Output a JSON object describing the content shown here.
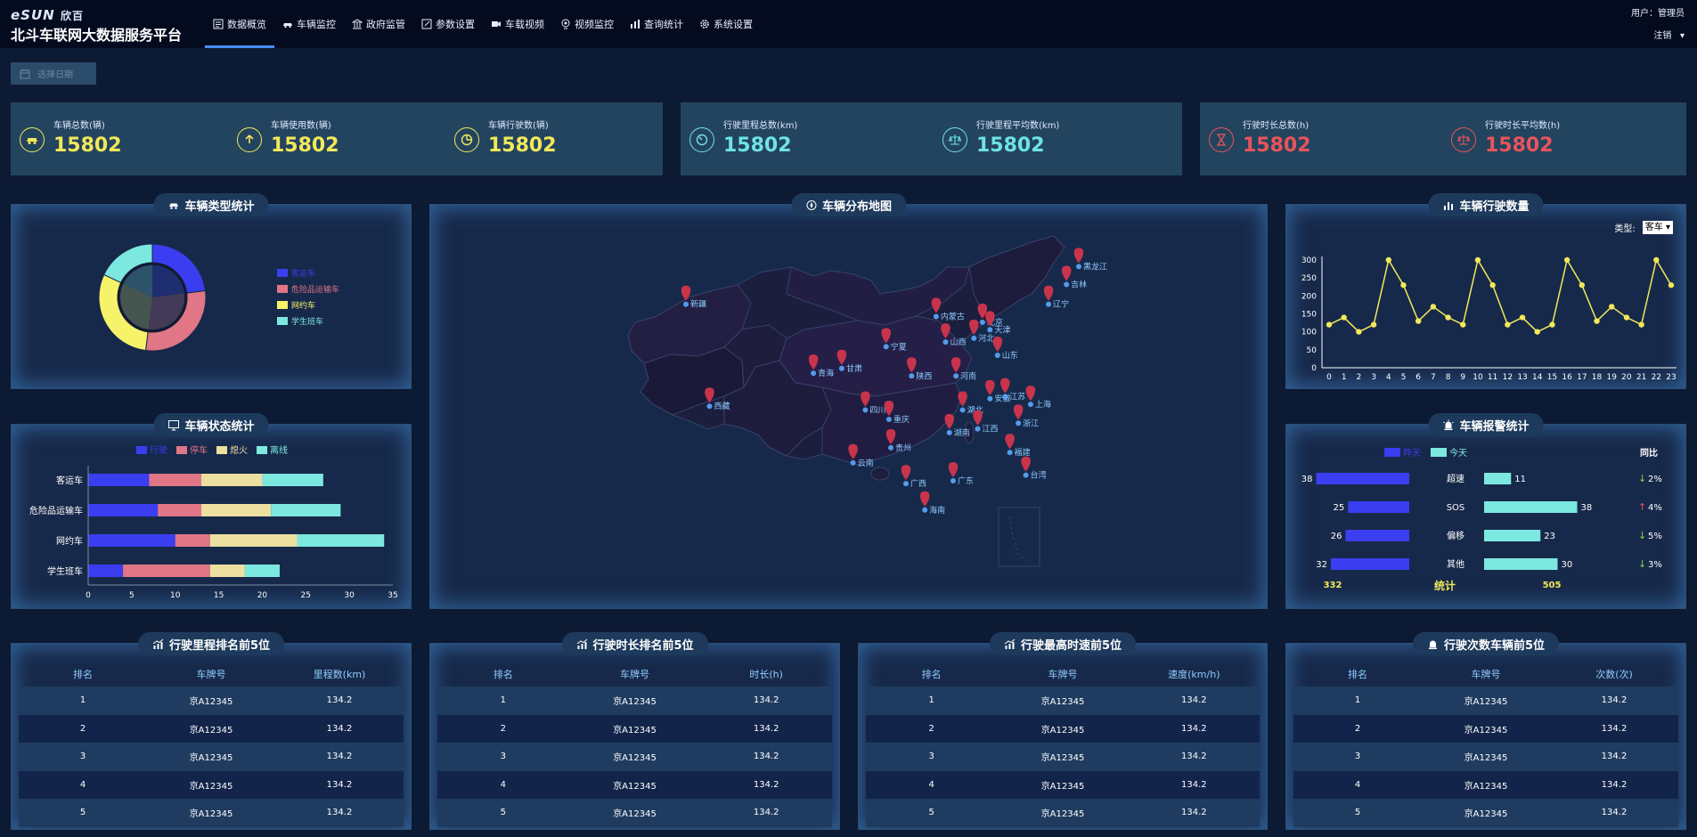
{
  "header": {
    "logo": "eSUN",
    "logo_cn": "欣百",
    "title": "北斗车联网大数据服务平台",
    "nav": [
      {
        "label": "数据概览",
        "icon": "dashboard-icon",
        "active": true
      },
      {
        "label": "车辆监控",
        "icon": "car-icon"
      },
      {
        "label": "政府监管",
        "icon": "government-icon"
      },
      {
        "label": "参数设置",
        "icon": "edit-icon"
      },
      {
        "label": "车载视频",
        "icon": "video-camera-icon"
      },
      {
        "label": "视频监控",
        "icon": "webcam-icon"
      },
      {
        "label": "查询统计",
        "icon": "bar-chart-icon"
      },
      {
        "label": "系统设置",
        "icon": "gear-icon"
      }
    ],
    "user_label": "用户：管理员",
    "logout_label": "注销"
  },
  "date_picker": {
    "placeholder": "选择日期"
  },
  "stats": [
    {
      "label": "车辆总数(辆)",
      "value": "15802",
      "icon": "car-icon",
      "color": "#f2e85a"
    },
    {
      "label": "车辆使用数(辆)",
      "value": "15802",
      "icon": "upload-icon",
      "color": "#f2e85a"
    },
    {
      "label": "车辆行驶数(辆)",
      "value": "15802",
      "icon": "pie-icon",
      "color": "#f2e85a"
    },
    {
      "label": "行驶里程总数(km)",
      "value": "15802",
      "icon": "timer-icon",
      "color": "#6fe3e3"
    },
    {
      "label": "行驶里程平均数(km)",
      "value": "15802",
      "icon": "scale-icon",
      "color": "#6fe3e3"
    },
    {
      "label": "行驶时长总数(h)",
      "value": "15802",
      "icon": "hourglass-icon",
      "color": "#e8545a"
    },
    {
      "label": "行驶时长平均数(h)",
      "value": "15802",
      "icon": "scale-icon",
      "color": "#e8545a"
    }
  ],
  "panels": {
    "vehicle_type": "车辆类型统计",
    "vehicle_status": "车辆状态统计",
    "map": "车辆分布地图",
    "travel_count": "车辆行驶数量",
    "alarm": "车辆报警统计",
    "mileage_rank": "行驶里程排名前5位",
    "duration_rank": "行驶时长排名前5位",
    "speed_rank": "行驶最高时速前5位",
    "trips_rank": "行驶次数车辆前5位"
  },
  "chart_data": [
    {
      "type": "pie",
      "name": "vehicle_type",
      "categories": [
        "客运车",
        "危险品运输车",
        "网约车",
        "学生班车"
      ],
      "values": [
        23,
        29,
        30,
        18
      ],
      "colors": [
        "#3a3ef0",
        "#e07686",
        "#f6f36a",
        "#7de8e0"
      ],
      "legend": "right"
    },
    {
      "type": "bar",
      "name": "vehicle_status",
      "orientation": "horizontal",
      "stacked": true,
      "categories": [
        "客运车",
        "危险品运输车",
        "网约车",
        "学生班车"
      ],
      "series": [
        {
          "name": "行驶",
          "values": [
            7,
            8,
            10,
            4
          ],
          "color": "#3a3ef0"
        },
        {
          "name": "停车",
          "values": [
            6,
            5,
            4,
            10
          ],
          "color": "#e07686"
        },
        {
          "name": "熄火",
          "values": [
            7,
            8,
            10,
            4
          ],
          "color": "#ecdfa0"
        },
        {
          "name": "离线",
          "values": [
            7,
            8,
            10,
            4
          ],
          "color": "#7de8e0"
        }
      ],
      "xlim": [
        0,
        35
      ],
      "xticks": [
        0,
        5,
        10,
        15,
        20,
        25,
        30,
        35
      ],
      "legend": "top"
    },
    {
      "type": "line",
      "name": "travel_count",
      "x": [
        0,
        1,
        2,
        3,
        4,
        5,
        6,
        7,
        8,
        9,
        10,
        11,
        12,
        13,
        14,
        15,
        16,
        17,
        18,
        19,
        20,
        21,
        22,
        23
      ],
      "values": [
        120,
        140,
        100,
        120,
        300,
        230,
        130,
        170,
        140,
        120,
        300,
        230,
        120,
        140,
        100,
        120,
        300,
        230,
        130,
        170,
        140,
        120,
        300,
        230
      ],
      "ylim": [
        0,
        300
      ],
      "yticks": [
        0,
        50,
        100,
        150,
        200,
        250,
        300
      ],
      "color": "#f2e85a",
      "selector_label": "类型:",
      "selector_value": "客车"
    },
    {
      "type": "bar",
      "name": "alarm",
      "categories": [
        "超速",
        "SOS",
        "偏移",
        "其他"
      ],
      "series": [
        {
          "name": "昨天",
          "values": [
            38,
            25,
            26,
            32
          ],
          "color": "#3a3ef0"
        },
        {
          "name": "今天",
          "values": [
            11,
            38,
            23,
            30
          ],
          "color": "#7de8e0"
        }
      ],
      "yoy_header": "同比",
      "yoy": [
        {
          "dir": "down",
          "value": "2%"
        },
        {
          "dir": "up",
          "value": "4%"
        },
        {
          "dir": "down",
          "value": "5%"
        },
        {
          "dir": "down",
          "value": "3%"
        }
      ],
      "total_label": "统计",
      "total_yesterday": "332",
      "total_today": "505"
    }
  ],
  "map": {
    "markers": [
      {
        "name": "新疆",
        "lon": 85.0,
        "lat": 41.8
      },
      {
        "name": "西藏",
        "lon": 87.5,
        "lat": 31.0
      },
      {
        "name": "宁夏",
        "lon": 106.2,
        "lat": 37.3
      },
      {
        "name": "甘肃",
        "lon": 101.5,
        "lat": 35.0
      },
      {
        "name": "青海",
        "lon": 98.5,
        "lat": 34.5
      },
      {
        "name": "内蒙古",
        "lon": 111.5,
        "lat": 40.5
      },
      {
        "name": "北京",
        "lon": 116.4,
        "lat": 39.9
      },
      {
        "name": "天津",
        "lon": 117.2,
        "lat": 39.1
      },
      {
        "name": "河北",
        "lon": 115.5,
        "lat": 38.2
      },
      {
        "name": "山西",
        "lon": 112.5,
        "lat": 37.8
      },
      {
        "name": "山东",
        "lon": 118.0,
        "lat": 36.4
      },
      {
        "name": "陕西",
        "lon": 108.9,
        "lat": 34.2
      },
      {
        "name": "河南",
        "lon": 113.6,
        "lat": 34.2
      },
      {
        "name": "四川",
        "lon": 104.0,
        "lat": 30.6
      },
      {
        "name": "重庆",
        "lon": 106.5,
        "lat": 29.6
      },
      {
        "name": "湖北",
        "lon": 114.3,
        "lat": 30.6
      },
      {
        "name": "安徽",
        "lon": 117.2,
        "lat": 31.8
      },
      {
        "name": "江苏",
        "lon": 118.8,
        "lat": 32.0
      },
      {
        "name": "上海",
        "lon": 121.5,
        "lat": 31.2
      },
      {
        "name": "浙江",
        "lon": 120.2,
        "lat": 29.2
      },
      {
        "name": "湖南",
        "lon": 112.9,
        "lat": 28.2
      },
      {
        "name": "江西",
        "lon": 115.9,
        "lat": 28.6
      },
      {
        "name": "贵州",
        "lon": 106.7,
        "lat": 26.6
      },
      {
        "name": "云南",
        "lon": 102.7,
        "lat": 25.0
      },
      {
        "name": "广西",
        "lon": 108.3,
        "lat": 22.8
      },
      {
        "name": "广东",
        "lon": 113.3,
        "lat": 23.1
      },
      {
        "name": "福建",
        "lon": 119.3,
        "lat": 26.1
      },
      {
        "name": "台湾",
        "lon": 121.0,
        "lat": 23.7
      },
      {
        "name": "海南",
        "lon": 110.3,
        "lat": 20.0
      },
      {
        "name": "辽宁",
        "lon": 123.4,
        "lat": 41.8
      },
      {
        "name": "吉林",
        "lon": 125.3,
        "lat": 43.9
      },
      {
        "name": "黑龙江",
        "lon": 126.6,
        "lat": 45.8
      }
    ]
  },
  "tables": {
    "mileage": {
      "headers": [
        "排名",
        "车牌号",
        "里程数(km)"
      ],
      "rows": [
        [
          "1",
          "京A12345",
          "134.2"
        ],
        [
          "2",
          "京A12345",
          "134.2"
        ],
        [
          "3",
          "京A12345",
          "134.2"
        ],
        [
          "4",
          "京A12345",
          "134.2"
        ],
        [
          "5",
          "京A12345",
          "134.2"
        ]
      ]
    },
    "duration": {
      "headers": [
        "排名",
        "车牌号",
        "时长(h)"
      ],
      "rows": [
        [
          "1",
          "京A12345",
          "134.2"
        ],
        [
          "2",
          "京A12345",
          "134.2"
        ],
        [
          "3",
          "京A12345",
          "134.2"
        ],
        [
          "4",
          "京A12345",
          "134.2"
        ],
        [
          "5",
          "京A12345",
          "134.2"
        ]
      ]
    },
    "speed": {
      "headers": [
        "排名",
        "车牌号",
        "速度(km/h)"
      ],
      "rows": [
        [
          "1",
          "京A12345",
          "134.2"
        ],
        [
          "2",
          "京A12345",
          "134.2"
        ],
        [
          "3",
          "京A12345",
          "134.2"
        ],
        [
          "4",
          "京A12345",
          "134.2"
        ],
        [
          "5",
          "京A12345",
          "134.2"
        ]
      ]
    },
    "trips": {
      "headers": [
        "排名",
        "车牌号",
        "次数(次)"
      ],
      "rows": [
        [
          "1",
          "京A12345",
          "134.2"
        ],
        [
          "2",
          "京A12345",
          "134.2"
        ],
        [
          "3",
          "京A12345",
          "134.2"
        ],
        [
          "4",
          "京A12345",
          "134.2"
        ],
        [
          "5",
          "京A12345",
          "134.2"
        ]
      ]
    }
  }
}
